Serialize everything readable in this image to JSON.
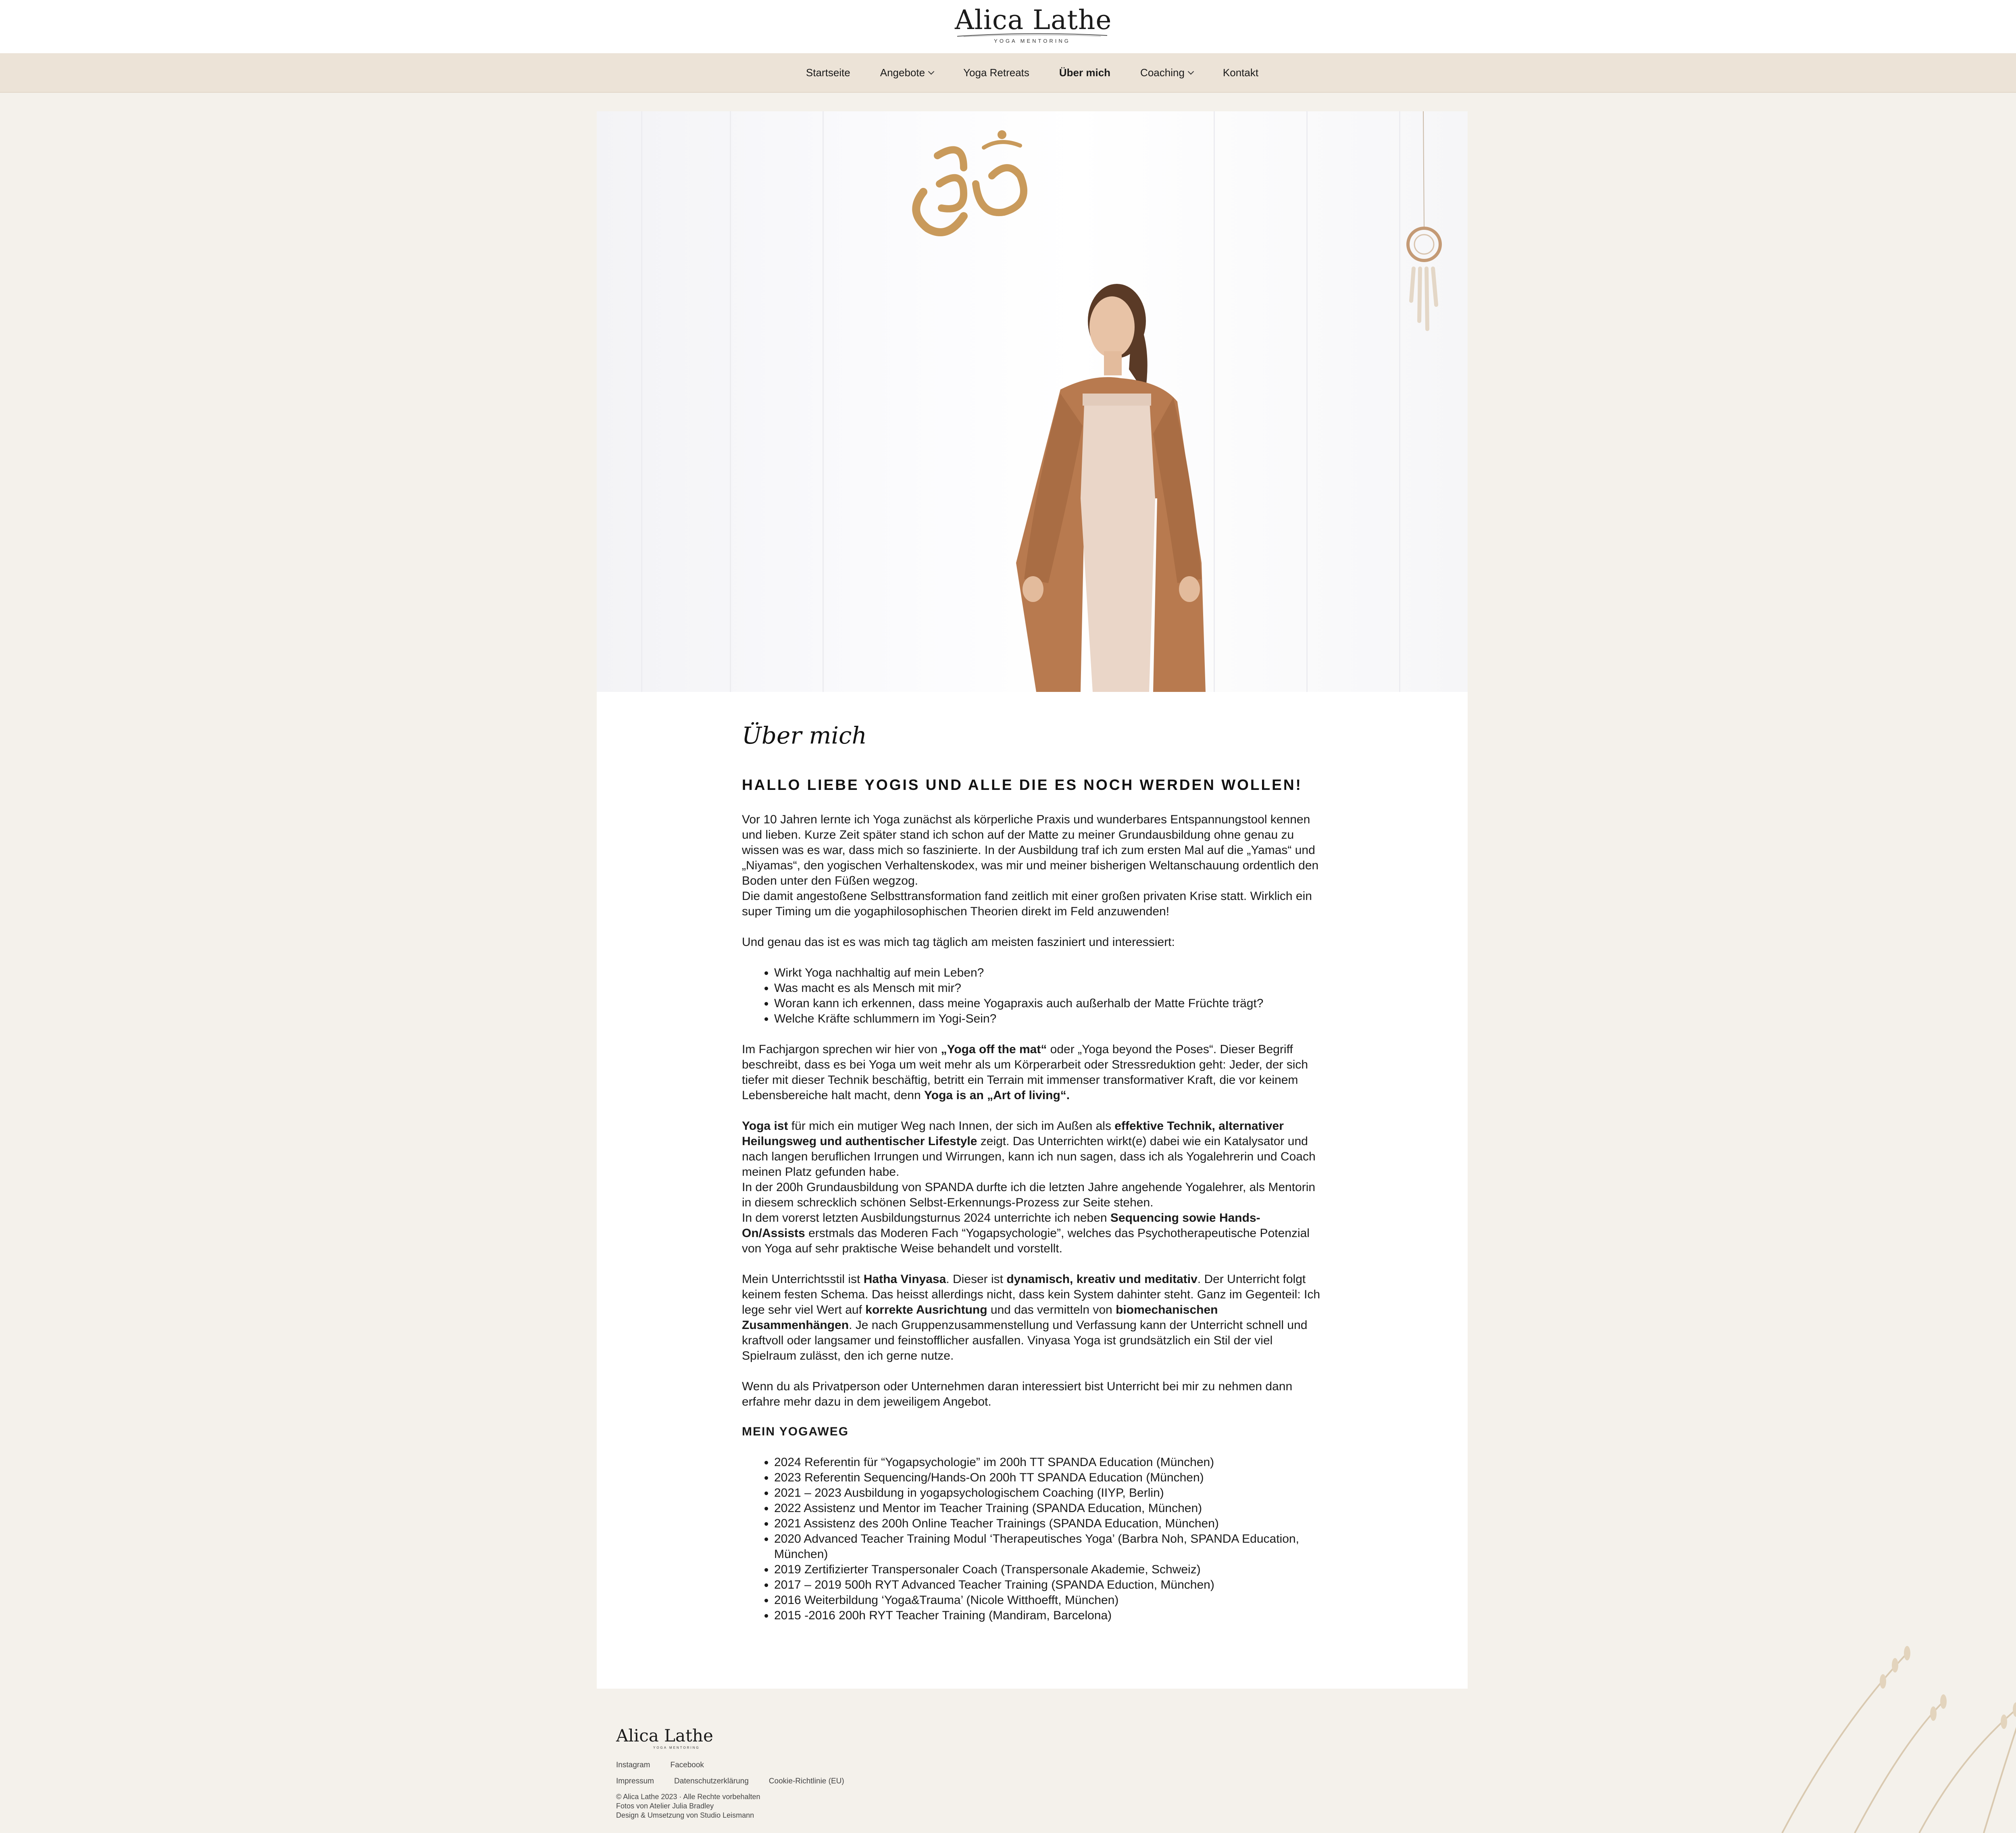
{
  "brand": {
    "name": "Alica Lathe",
    "subtitle": "YOGA MENTORING"
  },
  "nav": {
    "items": [
      {
        "label": "Startseite",
        "dropdown": false,
        "active": false
      },
      {
        "label": "Angebote",
        "dropdown": true,
        "active": false
      },
      {
        "label": "Yoga Retreats",
        "dropdown": false,
        "active": false
      },
      {
        "label": "Über mich",
        "dropdown": false,
        "active": true
      },
      {
        "label": "Coaching",
        "dropdown": true,
        "active": false
      },
      {
        "label": "Kontakt",
        "dropdown": false,
        "active": false
      }
    ]
  },
  "page": {
    "title": "Über mich",
    "lead": "HALLO LIEBE YOGIS UND ALLE DIE ES NOCH WERDEN WOLLEN!",
    "p1": "Vor 10 Jahren lernte ich Yoga zunächst als körperliche Praxis und wunderbares Entspannungstool kennen und lieben. Kurze Zeit später stand ich schon auf der Matte zu meiner Grundausbildung ohne genau zu wissen was es war, dass mich so faszinierte. In der Ausbildung traf ich zum ersten Mal auf die „Yamas“ und „Niyamas“, den yogischen Verhaltenskodex, was mir und meiner bisherigen Weltanschauung ordentlich den Boden unter den Füßen wegzog.",
    "p1b": "Die damit angestoßene Selbsttransformation fand zeitlich mit einer großen privaten Krise statt. Wirklich ein super Timing um die yogaphilosophischen Theorien direkt im Feld anzuwenden!",
    "p2": "Und genau das ist es was mich tag täglich am meisten fasziniert und interessiert:",
    "questions": [
      "Wirkt Yoga nachhaltig auf mein Leben?",
      "Was macht es als Mensch mit mir?",
      "Woran kann ich erkennen, dass meine Yogapraxis auch außerhalb der Matte Früchte trägt?",
      "Welche Kräfte schlummern im Yogi-Sein?"
    ],
    "p3": {
      "a": "Im Fachjargon sprechen wir hier von ",
      "b": "„Yoga off the mat“",
      "c": " oder „Yoga beyond the Poses“. Dieser Begriff beschreibt, dass es bei Yoga um weit mehr als um Körperarbeit oder Stressreduktion geht: Jeder, der sich tiefer mit dieser Technik beschäftig, betritt ein Terrain mit immenser transformativer Kraft, die vor keinem Lebensbereiche halt macht, denn ",
      "d": "Yoga is an „Art of living“."
    },
    "p4": {
      "a": "Yoga ist",
      "b": " für mich ein mutiger Weg nach Innen, der sich im Außen als ",
      "c": "effektive Technik, alternativer Heilungsweg und authentischer Lifestyle",
      "d": " zeigt. Das Unterrichten wirkt(e) dabei wie ein Katalysator und nach langen beruflichen Irrungen und Wirrungen, kann ich nun sagen, dass ich als Yogalehrerin und Coach meinen Platz gefunden habe.",
      "e": "In der 200h Grundausbildung von SPANDA durfte ich die letzten Jahre angehende Yogalehrer, als Mentorin in diesem schrecklich schönen Selbst-Erkennungs-Prozess zur Seite stehen.",
      "f": "In dem vorerst letzten Ausbildungsturnus 2024 unterrichte ich neben ",
      "g": "Sequencing sowie Hands-On/Assists",
      "h": " erstmals das Moderen Fach “Yogapsychologie”, welches das Psychotherapeutische Potenzial von Yoga auf sehr praktische Weise behandelt und vorstellt."
    },
    "p5": {
      "a": "Mein Unterrichtsstil ist ",
      "b": "Hatha Vinyasa",
      "c": ". Dieser ist ",
      "d": "dynamisch, kreativ und meditativ",
      "e": ". Der Unterricht folgt keinem festen Schema. Das heisst allerdings nicht, dass kein System dahinter steht. Ganz im Gegenteil: Ich lege sehr viel Wert auf ",
      "f": "korrekte Ausrichtung",
      "g": " und das vermitteln von ",
      "h": "biomechanischen Zusammenhängen",
      "i": ". Je nach Gruppenzusammenstellung und Verfassung kann der Unterricht schnell und kraftvoll oder langsamer und feinstofflicher ausfallen. Vinyasa Yoga ist grundsätzlich ein Stil der viel Spielraum zulässt, den ich gerne nutze."
    },
    "p6": "Wenn du als Privatperson oder Unternehmen daran interessiert bist Unterricht bei mir zu nehmen dann erfahre mehr dazu in dem jeweiligem Angebot.",
    "yogaweg_title": "MEIN YOGAWEG",
    "yogaweg": [
      "2024 Referentin für “Yogapsychologie” im 200h TT SPANDA Education (München)",
      "2023 Referentin Sequencing/Hands-On 200h TT SPANDA Education (München)",
      "2021 – 2023 Ausbildung in yogapsychologischem Coaching (IIYP, Berlin)",
      "2022 Assistenz und Mentor im Teacher Training (SPANDA Education, München)",
      "2021 Assistenz des 200h Online Teacher Trainings (SPANDA Education, München)",
      "2020 Advanced Teacher Training Modul ‘Therapeutisches Yoga’ (Barbra Noh, SPANDA Education, München)",
      "2019 Zertifizierter Transpersonaler Coach (Transpersonale Akademie, Schweiz)",
      "2017 – 2019 500h RYT Advanced Teacher Training (SPANDA Eduction, München)",
      "2016 Weiterbildung ‘Yoga&Trauma’ (Nicole Witthoefft, München)",
      "2015 -2016 200h RYT Teacher Training (Mandiram, Barcelona)"
    ]
  },
  "footer": {
    "social": [
      "Instagram",
      "Facebook"
    ],
    "legal": [
      "Impressum",
      "Datenschutzerklärung",
      "Cookie-Richtlinie (EU)"
    ],
    "copyright": "© Alica Lathe 2023 · Alle Rechte vorbehalten",
    "photos": "Fotos von Atelier Julia Bradley",
    "design": "Design & Umsetzung von Studio Leismann"
  },
  "colors": {
    "page_bg": "#f4f1eb",
    "nav_bg": "#ece3d7",
    "card_bg": "#ffffff",
    "gold": "#c99a5b",
    "cardigan": "#b87a4f",
    "jumpsuit": "#ead6c8"
  }
}
